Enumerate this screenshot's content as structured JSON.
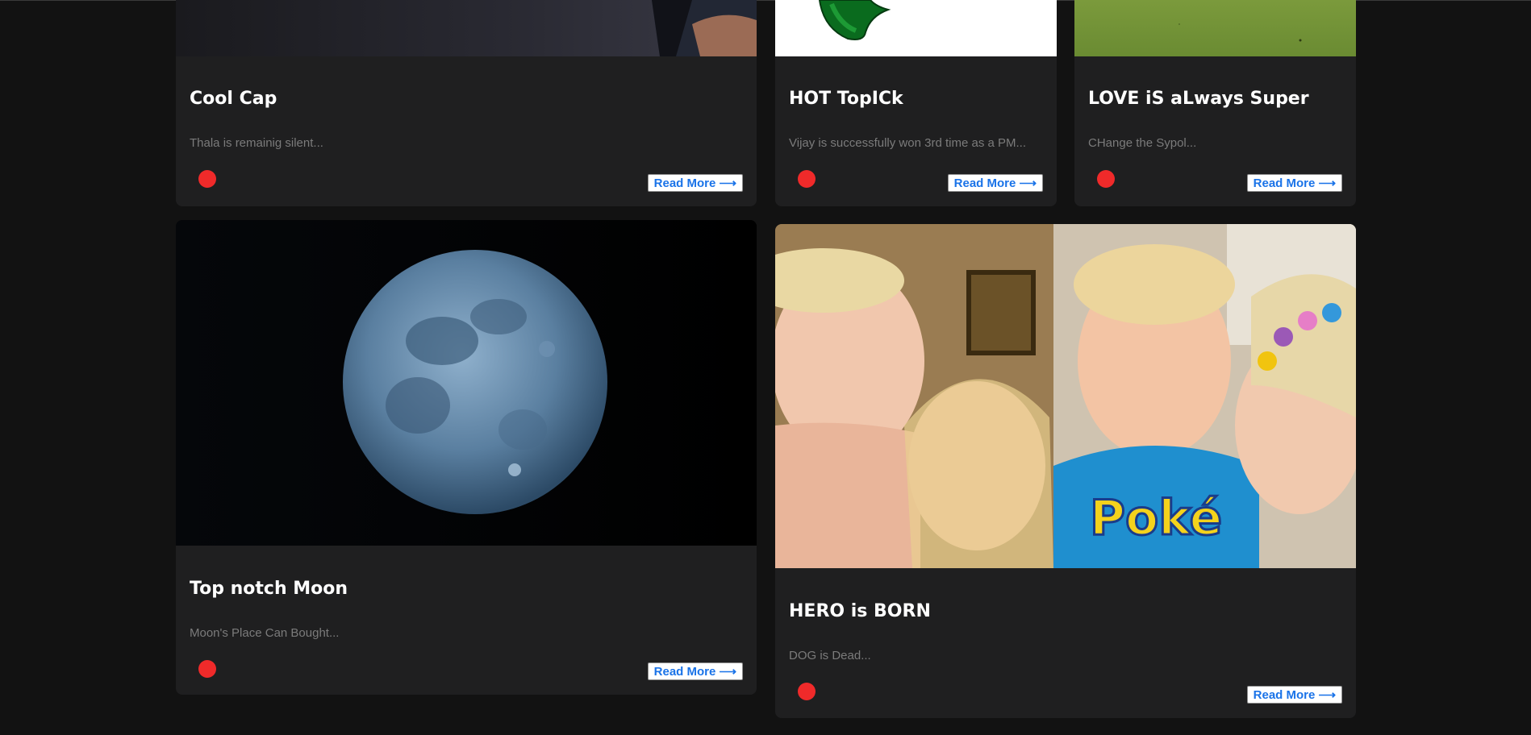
{
  "cards": [
    {
      "title": "Cool Cap",
      "excerpt": "Thala is remainig silent...",
      "read_more": "Read More ⟶",
      "image": "dark-photo-fragment"
    },
    {
      "title": "HOT TopICk",
      "excerpt": "Vijay is successfully won 3rd time as a PM...",
      "read_more": "Read More ⟶",
      "image": "green-logo-fragment"
    },
    {
      "title": "LOVE iS aLways Super",
      "excerpt": "CHange the Sypol...",
      "read_more": "Read More ⟶",
      "image": "grass-field-fragment"
    },
    {
      "title": "Top notch Moon",
      "excerpt": "Moon's Place Can Bought...",
      "read_more": "Read More ⟶",
      "image": "full-moon-photo"
    },
    {
      "title": "HERO is BORN",
      "excerpt": "DOG is Dead...",
      "read_more": "Read More ⟶",
      "image": "children-photo"
    }
  ],
  "colors": {
    "background": "#121212",
    "card": "#1f1f20",
    "dot": "#f02a2a",
    "link": "#1a73e8"
  }
}
